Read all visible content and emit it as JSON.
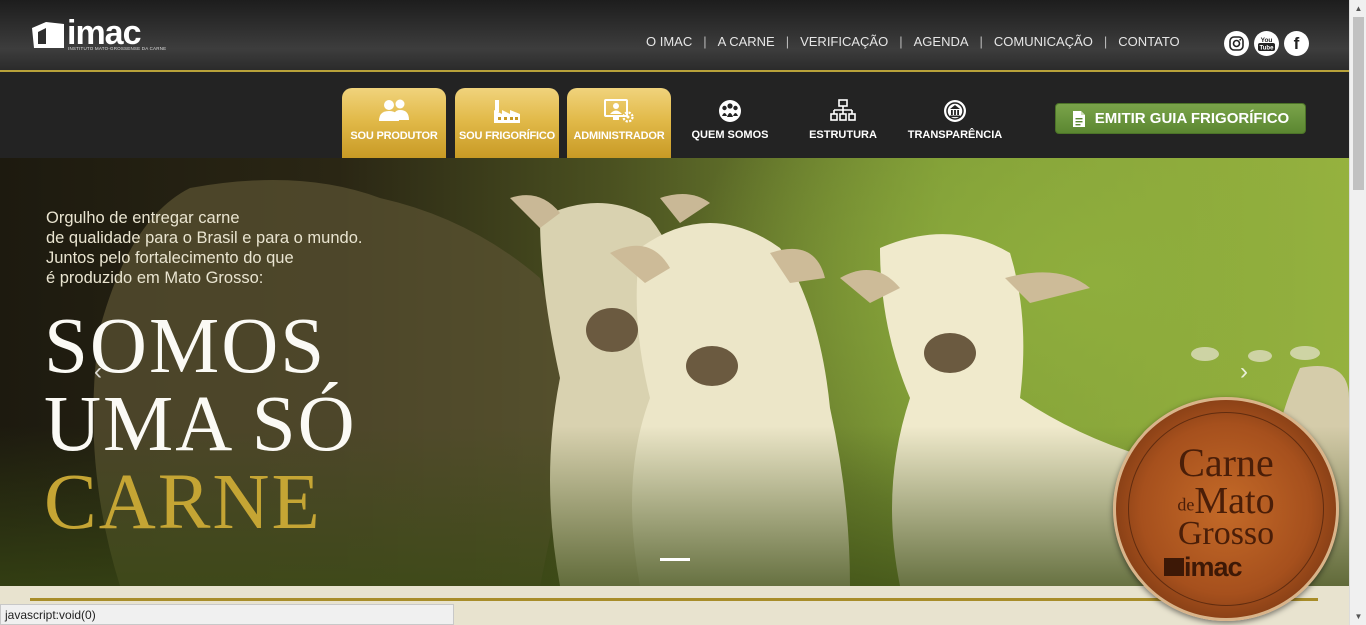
{
  "brand": {
    "wordmark": "imac",
    "tagline": "INSTITUTO MATO-GROSSENSE DA CARNE"
  },
  "top_nav": [
    {
      "label": "O IMAC"
    },
    {
      "label": "A CARNE"
    },
    {
      "label": "VERIFICAÇÃO"
    },
    {
      "label": "AGENDA"
    },
    {
      "label": "COMUNICAÇÃO"
    },
    {
      "label": "CONTATO"
    }
  ],
  "social": [
    {
      "icon": "instagram-icon"
    },
    {
      "icon": "youtube-icon",
      "text_top": "You",
      "text_bottom": "Tube"
    },
    {
      "icon": "facebook-icon",
      "glyph": "f"
    }
  ],
  "main_nav": {
    "tabs": [
      {
        "label": "SOU PRODUTOR",
        "icon": "users-icon"
      },
      {
        "label": "SOU FRIGORÍFICO",
        "icon": "factory-icon"
      },
      {
        "label": "ADMINISTRADOR",
        "icon": "admin-monitor-icon"
      }
    ],
    "links": [
      {
        "label": "QUEM SOMOS",
        "icon": "people-globe-icon"
      },
      {
        "label": "ESTRUTURA",
        "icon": "org-chart-icon"
      },
      {
        "label": "TRANSPARÊNCIA",
        "icon": "building-circle-icon"
      }
    ],
    "cta": {
      "label": "EMITIR GUIA FRIGORÍFICO",
      "icon": "document-icon"
    }
  },
  "hero": {
    "tagline_lines": [
      "Orgulho de entregar carne",
      "de qualidade para o Brasil e para o mundo.",
      "Juntos pelo fortalecimento do que",
      "é produzido em Mato Grosso:"
    ],
    "headline_1": "SOMOS",
    "headline_2": "UMA SÓ",
    "headline_3": "CARNE",
    "prev_glyph": "‹",
    "next_glyph": "›"
  },
  "seal": {
    "line1": "Carne",
    "line2_small": "de",
    "line2": "Mato",
    "line3": "Grosso",
    "brand": "imac"
  },
  "status_bar": "javascript:void(0)",
  "colors": {
    "gold": "#c5a534",
    "tab_gold": "#e2ba4a",
    "cta_green": "#5b8731",
    "dark_bg": "#232323"
  }
}
